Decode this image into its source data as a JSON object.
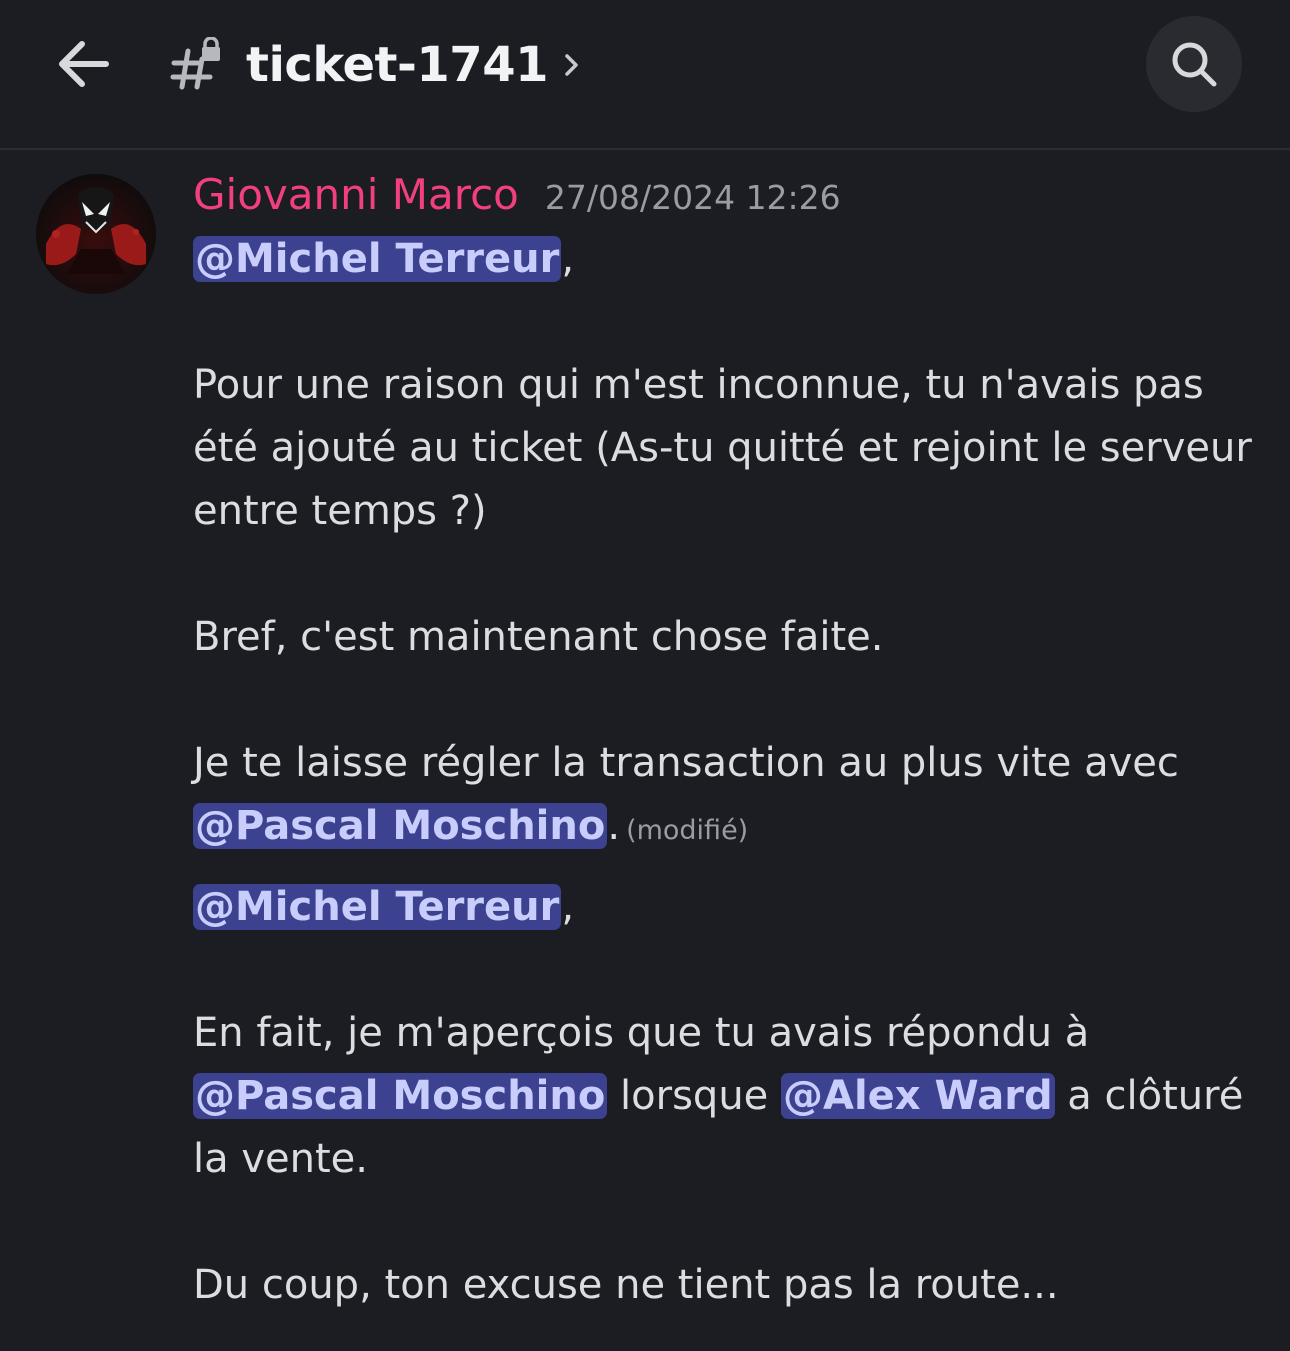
{
  "header": {
    "back_icon": "arrow-left-icon",
    "channel_icon": "locked-hashtag-icon",
    "channel_name": "ticket-1741",
    "chevron_icon": "chevron-right-icon",
    "search_icon": "search-icon"
  },
  "message": {
    "author": "Giovanni Marco",
    "author_color": "#f23f7e",
    "timestamp": "27/08/2024 12:26",
    "first": {
      "mention1": "@Michel Terreur",
      "comma1": ",",
      "p1": "Pour une raison qui m'est inconnue, tu n'avais pas été ajouté au ticket (As-tu quitté et rejoint le serveur entre temps ?)",
      "p2": "Bref, c'est maintenant chose faite.",
      "p3_text": "Je te laisse régler la transaction au plus vite avec ",
      "p3_mention": "@Pascal Moschino",
      "p3_end": ".",
      "edited_label": "(modifié)"
    },
    "second": {
      "mention1": "@Michel Terreur",
      "comma1": ",",
      "p1_text": "En fait, je m'aperçois que tu avais répondu à ",
      "p1_mention1": "@Pascal Moschino",
      "p1_mid": " lorsque ",
      "p1_mention2": "@Alex Ward",
      "p1_end": " a clôturé la vente.",
      "p2": "Du coup, ton excuse ne tient pas la route..."
    }
  },
  "colors": {
    "background": "#1c1d22",
    "mention_bg": "#3c4190",
    "mention_text": "#c9cdfb",
    "timestamp": "#9a9ca3"
  }
}
